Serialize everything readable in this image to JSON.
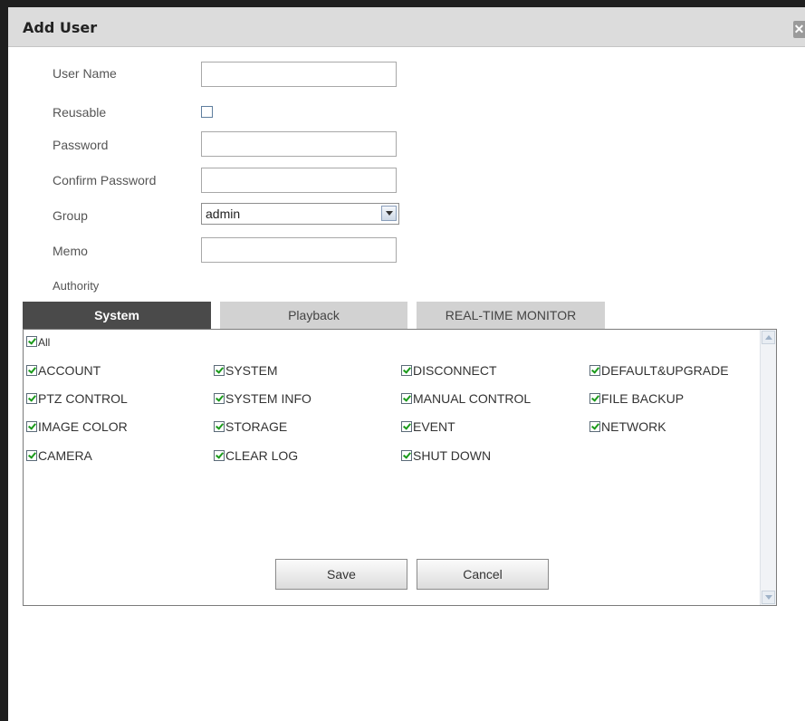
{
  "dialog": {
    "title": "Add User",
    "close_glyph": "✕"
  },
  "form": {
    "user_name_label": "User Name",
    "user_name_value": "",
    "reusable_label": "Reusable",
    "reusable_checked": false,
    "password_label": "Password",
    "password_value": "",
    "confirm_password_label": "Confirm Password",
    "confirm_password_value": "",
    "group_label": "Group",
    "group_value": "admin",
    "memo_label": "Memo",
    "memo_value": "",
    "authority_label": "Authority"
  },
  "tabs": [
    {
      "label": "System",
      "active": true
    },
    {
      "label": "Playback",
      "active": false
    },
    {
      "label": "REAL-TIME MONITOR",
      "active": false
    }
  ],
  "permissions": {
    "all_label": "All",
    "items": [
      [
        "ACCOUNT",
        "SYSTEM",
        "DISCONNECT",
        "DEFAULT&UPGRADE"
      ],
      [
        "PTZ CONTROL",
        "SYSTEM INFO",
        "MANUAL CONTROL",
        "FILE BACKUP"
      ],
      [
        "IMAGE COLOR",
        "STORAGE",
        "EVENT",
        "NETWORK"
      ],
      [
        "CAMERA",
        "CLEAR LOG",
        "SHUT DOWN"
      ]
    ],
    "checked": true
  },
  "buttons": {
    "save_label": "Save",
    "cancel_label": "Cancel"
  },
  "colors": {
    "active_tab": "#4a4a4a",
    "inactive_tab": "#d2d2d2",
    "check_mark": "#1a9a1a"
  }
}
